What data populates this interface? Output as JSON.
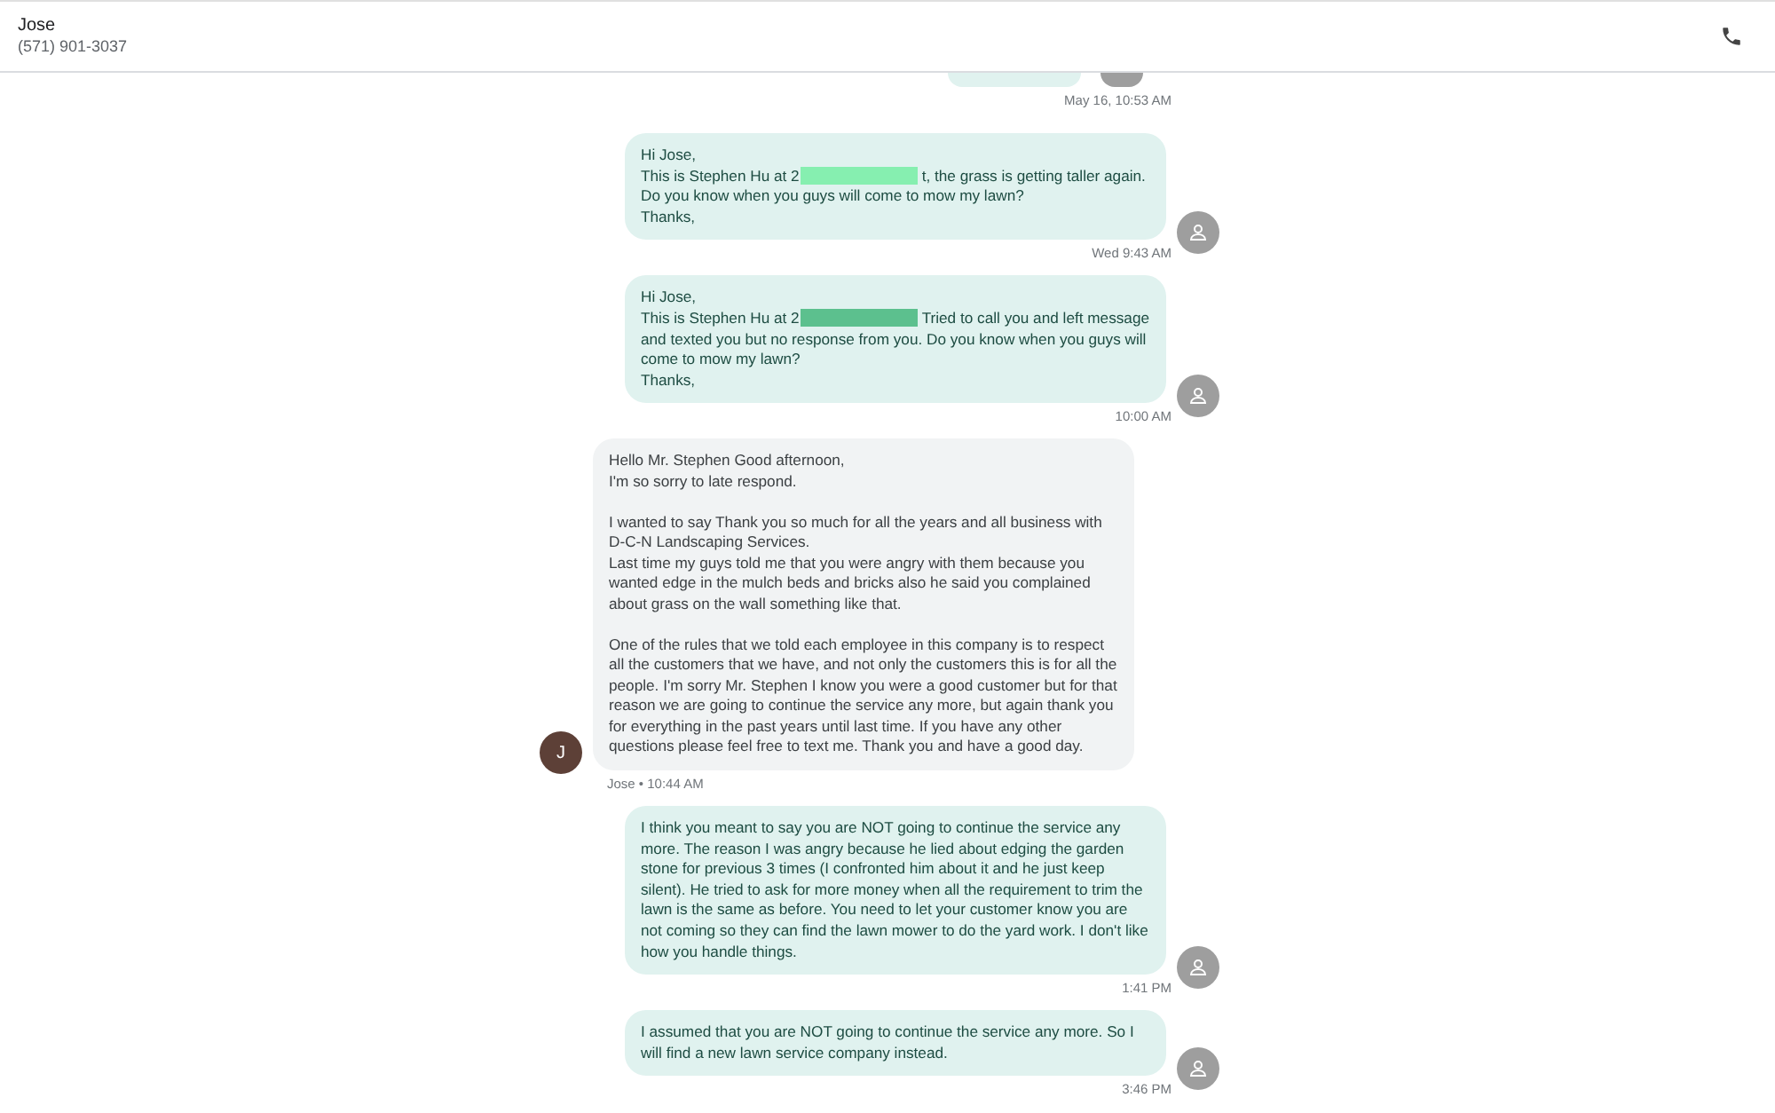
{
  "header": {
    "name": "Jose",
    "phone": "(571) 901-3037"
  },
  "messages": [
    {
      "kind": "cut_off",
      "time": "May 16, 10:53 AM"
    },
    {
      "kind": "sent",
      "time": "Wed 9:43 AM",
      "paragraphs": [
        [
          {
            "kind": "plain",
            "text": "Hi Jose,"
          },
          {
            "kind": "redacted",
            "before": "This is Stephen Hu at 2",
            "color": "#86efb0",
            "after": "t, the grass is getting taller again."
          },
          {
            "kind": "plain",
            "text": "Do you know when you guys will come to mow my lawn?"
          },
          {
            "kind": "plain",
            "text": "Thanks,"
          }
        ]
      ]
    },
    {
      "kind": "sent",
      "time": "10:00 AM",
      "paragraphs": [
        [
          {
            "kind": "plain",
            "text": "Hi Jose,"
          },
          {
            "kind": "redacted",
            "before": "This is Stephen Hu at 2",
            "color": "#5cc08e",
            "after": "Tried to call you and left message and texted you but no response from you. Do you know when you guys will come to mow my lawn?"
          },
          {
            "kind": "plain",
            "text": "Thanks,"
          }
        ]
      ]
    },
    {
      "kind": "received",
      "avatar_letter": "J",
      "meta": "Jose • 10:44 AM",
      "paragraphs": [
        [
          {
            "kind": "plain",
            "text": "Hello Mr. Stephen Good afternoon,"
          },
          {
            "kind": "plain",
            "text": "I'm so sorry to late respond."
          }
        ],
        [
          {
            "kind": "plain",
            "text": "I wanted to say Thank you so much for all the years and all business with D-C-N Landscaping Services."
          },
          {
            "kind": "plain",
            "text": "Last time my guys told me that you were angry with them because you wanted edge in the mulch beds and bricks also he said you complained about grass on the wall something like that."
          }
        ],
        [
          {
            "kind": "plain",
            "text": "One of the rules that we told each employee in this company is to respect all the customers that we have, and not only the customers this is for all the people.  I'm sorry Mr. Stephen I know you were a good customer but for that reason we are going to continue the service any more, but again thank you for everything in the past years until last time. If you have any other questions please feel free to text me. Thank you and have a good day."
          }
        ]
      ]
    },
    {
      "kind": "sent",
      "time": "1:41 PM",
      "paragraphs": [
        [
          {
            "kind": "plain",
            "text": "I think you meant to say you are NOT going to continue the service any more. The reason I was angry because he lied about edging the garden stone for previous 3 times (I confronted him about it and he just keep silent). He tried to ask for more money when all the requirement to trim the lawn is the same as before. You need to let your customer know you are not coming so they can find the lawn mower to do the yard work.  I don't like how you handle things."
          }
        ]
      ]
    },
    {
      "kind": "sent",
      "time": "3:46 PM",
      "paragraphs": [
        [
          {
            "kind": "plain",
            "text": "I assumed that you are NOT going to continue the service any more. So I will find a new lawn service company instead."
          }
        ]
      ]
    }
  ]
}
